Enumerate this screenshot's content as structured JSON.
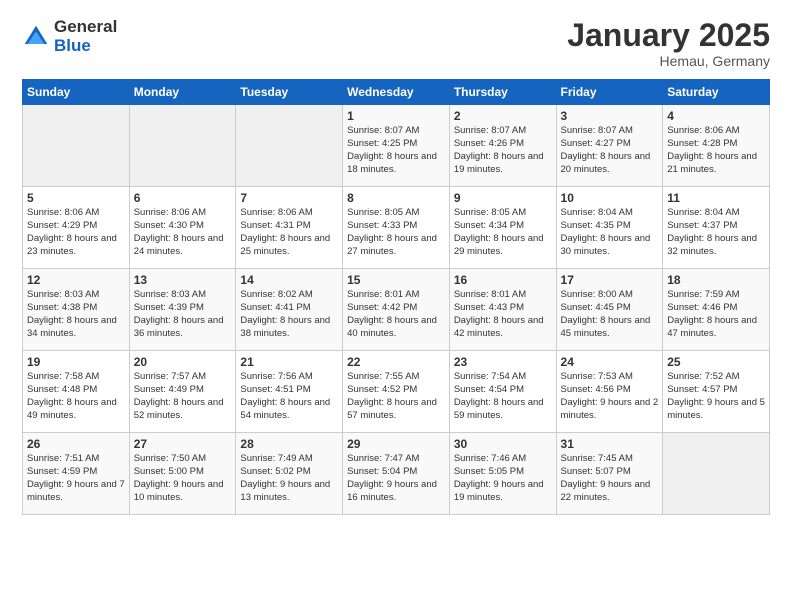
{
  "logo": {
    "general": "General",
    "blue": "Blue"
  },
  "header": {
    "title": "January 2025",
    "subtitle": "Hemau, Germany"
  },
  "weekdays": [
    "Sunday",
    "Monday",
    "Tuesday",
    "Wednesday",
    "Thursday",
    "Friday",
    "Saturday"
  ],
  "weeks": [
    [
      {
        "day": "",
        "empty": true
      },
      {
        "day": "",
        "empty": true
      },
      {
        "day": "",
        "empty": true
      },
      {
        "day": "1",
        "sunrise": "8:07 AM",
        "sunset": "4:25 PM",
        "daylight": "8 hours and 18 minutes."
      },
      {
        "day": "2",
        "sunrise": "8:07 AM",
        "sunset": "4:26 PM",
        "daylight": "8 hours and 19 minutes."
      },
      {
        "day": "3",
        "sunrise": "8:07 AM",
        "sunset": "4:27 PM",
        "daylight": "8 hours and 20 minutes."
      },
      {
        "day": "4",
        "sunrise": "8:06 AM",
        "sunset": "4:28 PM",
        "daylight": "8 hours and 21 minutes."
      }
    ],
    [
      {
        "day": "5",
        "sunrise": "8:06 AM",
        "sunset": "4:29 PM",
        "daylight": "8 hours and 23 minutes."
      },
      {
        "day": "6",
        "sunrise": "8:06 AM",
        "sunset": "4:30 PM",
        "daylight": "8 hours and 24 minutes."
      },
      {
        "day": "7",
        "sunrise": "8:06 AM",
        "sunset": "4:31 PM",
        "daylight": "8 hours and 25 minutes."
      },
      {
        "day": "8",
        "sunrise": "8:05 AM",
        "sunset": "4:33 PM",
        "daylight": "8 hours and 27 minutes."
      },
      {
        "day": "9",
        "sunrise": "8:05 AM",
        "sunset": "4:34 PM",
        "daylight": "8 hours and 29 minutes."
      },
      {
        "day": "10",
        "sunrise": "8:04 AM",
        "sunset": "4:35 PM",
        "daylight": "8 hours and 30 minutes."
      },
      {
        "day": "11",
        "sunrise": "8:04 AM",
        "sunset": "4:37 PM",
        "daylight": "8 hours and 32 minutes."
      }
    ],
    [
      {
        "day": "12",
        "sunrise": "8:03 AM",
        "sunset": "4:38 PM",
        "daylight": "8 hours and 34 minutes."
      },
      {
        "day": "13",
        "sunrise": "8:03 AM",
        "sunset": "4:39 PM",
        "daylight": "8 hours and 36 minutes."
      },
      {
        "day": "14",
        "sunrise": "8:02 AM",
        "sunset": "4:41 PM",
        "daylight": "8 hours and 38 minutes."
      },
      {
        "day": "15",
        "sunrise": "8:01 AM",
        "sunset": "4:42 PM",
        "daylight": "8 hours and 40 minutes."
      },
      {
        "day": "16",
        "sunrise": "8:01 AM",
        "sunset": "4:43 PM",
        "daylight": "8 hours and 42 minutes."
      },
      {
        "day": "17",
        "sunrise": "8:00 AM",
        "sunset": "4:45 PM",
        "daylight": "8 hours and 45 minutes."
      },
      {
        "day": "18",
        "sunrise": "7:59 AM",
        "sunset": "4:46 PM",
        "daylight": "8 hours and 47 minutes."
      }
    ],
    [
      {
        "day": "19",
        "sunrise": "7:58 AM",
        "sunset": "4:48 PM",
        "daylight": "8 hours and 49 minutes."
      },
      {
        "day": "20",
        "sunrise": "7:57 AM",
        "sunset": "4:49 PM",
        "daylight": "8 hours and 52 minutes."
      },
      {
        "day": "21",
        "sunrise": "7:56 AM",
        "sunset": "4:51 PM",
        "daylight": "8 hours and 54 minutes."
      },
      {
        "day": "22",
        "sunrise": "7:55 AM",
        "sunset": "4:52 PM",
        "daylight": "8 hours and 57 minutes."
      },
      {
        "day": "23",
        "sunrise": "7:54 AM",
        "sunset": "4:54 PM",
        "daylight": "8 hours and 59 minutes."
      },
      {
        "day": "24",
        "sunrise": "7:53 AM",
        "sunset": "4:56 PM",
        "daylight": "9 hours and 2 minutes."
      },
      {
        "day": "25",
        "sunrise": "7:52 AM",
        "sunset": "4:57 PM",
        "daylight": "9 hours and 5 minutes."
      }
    ],
    [
      {
        "day": "26",
        "sunrise": "7:51 AM",
        "sunset": "4:59 PM",
        "daylight": "9 hours and 7 minutes."
      },
      {
        "day": "27",
        "sunrise": "7:50 AM",
        "sunset": "5:00 PM",
        "daylight": "9 hours and 10 minutes."
      },
      {
        "day": "28",
        "sunrise": "7:49 AM",
        "sunset": "5:02 PM",
        "daylight": "9 hours and 13 minutes."
      },
      {
        "day": "29",
        "sunrise": "7:47 AM",
        "sunset": "5:04 PM",
        "daylight": "9 hours and 16 minutes."
      },
      {
        "day": "30",
        "sunrise": "7:46 AM",
        "sunset": "5:05 PM",
        "daylight": "9 hours and 19 minutes."
      },
      {
        "day": "31",
        "sunrise": "7:45 AM",
        "sunset": "5:07 PM",
        "daylight": "9 hours and 22 minutes."
      },
      {
        "day": "",
        "empty": true
      }
    ]
  ]
}
